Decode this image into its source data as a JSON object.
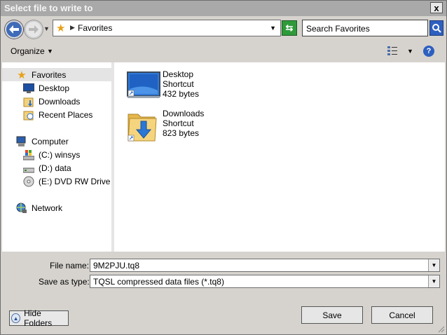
{
  "window": {
    "title": "Select file to write to",
    "close_glyph": "x"
  },
  "navbar": {
    "address": "Favorites",
    "search_placeholder": "Search Favorites",
    "address_icon": "favorites-star-icon"
  },
  "toolbar": {
    "organize_label": "Organize"
  },
  "navpane": {
    "groups": [
      {
        "label": "Favorites",
        "icon": "favorites-star-icon",
        "items": [
          {
            "label": "Desktop",
            "icon": "desktop-icon"
          },
          {
            "label": "Downloads",
            "icon": "downloads-icon"
          },
          {
            "label": "Recent Places",
            "icon": "recent-places-icon"
          }
        ]
      },
      {
        "label": "Computer",
        "icon": "computer-icon",
        "items": [
          {
            "label": "(C:) winsys",
            "icon": "system-drive-icon"
          },
          {
            "label": "(D:) data",
            "icon": "hard-drive-icon"
          },
          {
            "label": "(E:) DVD RW Drive - D",
            "icon": "dvd-drive-icon"
          }
        ]
      },
      {
        "label": "Network",
        "icon": "network-icon",
        "items": []
      }
    ]
  },
  "files": [
    {
      "name": "Desktop",
      "type": "Shortcut",
      "size": "432 bytes",
      "icon": "desktop-shortcut-icon"
    },
    {
      "name": "Downloads",
      "type": "Shortcut",
      "size": "823 bytes",
      "icon": "downloads-folder-icon"
    }
  ],
  "form": {
    "file_name_label": "File name:",
    "file_name_value": "9M2PJU.tq8",
    "save_type_label": "Save as type:",
    "save_type_value": "TQSL compressed data files (*.tq8)"
  },
  "buttons": {
    "hide_folders": "Hide Folders",
    "save": "Save",
    "cancel": "Cancel"
  }
}
